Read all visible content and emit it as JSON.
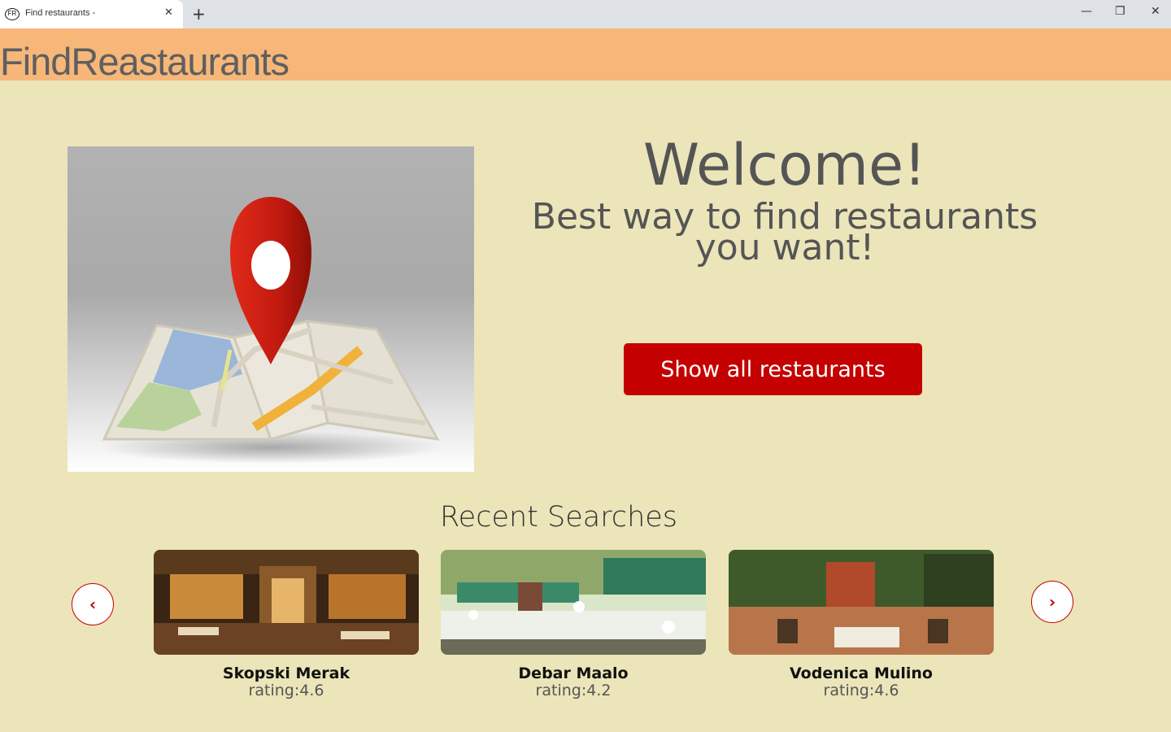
{
  "browser": {
    "tab_title": "Find restaurants -",
    "favicon_text": "FR",
    "close_glyph": "✕",
    "new_tab_glyph": "+",
    "minimize_glyph": "—",
    "restore_glyph": "❐",
    "window_close_glyph": "✕"
  },
  "header": {
    "brand": "FindReastaurants"
  },
  "hero": {
    "image_icon": "map-pin-icon",
    "welcome": "Welcome!",
    "tagline_line1": "Best way to find restaurants",
    "tagline_line2": "you want!",
    "cta_label": "Show all restaurants"
  },
  "recent": {
    "title": "Recent Searches",
    "prev_glyph": "‹",
    "next_glyph": "›",
    "cards": [
      {
        "name": "Skopski Merak",
        "rating": "rating:4.6"
      },
      {
        "name": "Debar Maalo",
        "rating": "rating:4.2"
      },
      {
        "name": "Vodenica Mulino",
        "rating": "rating:4.6"
      }
    ]
  },
  "colors": {
    "page_bg": "#ebe5b9",
    "header_bg": "#f6b779",
    "accent": "#c40000",
    "text": "#555555"
  }
}
